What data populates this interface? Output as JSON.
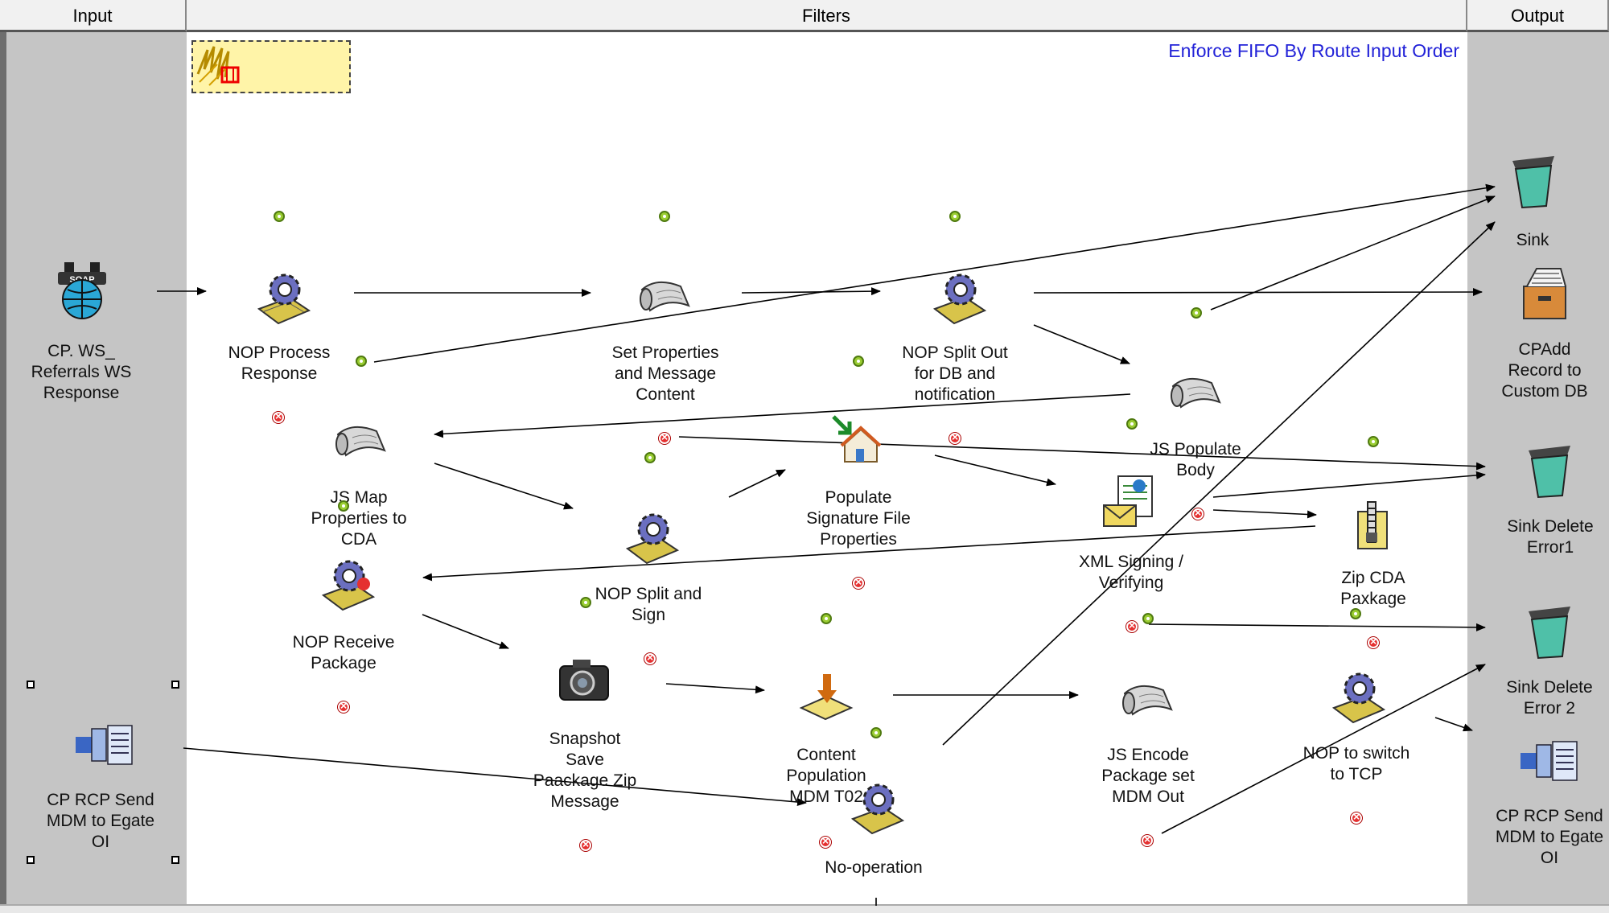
{
  "columns": {
    "input": "Input",
    "filters": "Filters",
    "output": "Output"
  },
  "banner": "Enforce FIFO By Route Input Order",
  "inputs": [
    {
      "label": "CP. WS_\nReferrals WS\nResponse",
      "icon": "soap-globe-icon"
    },
    {
      "label": "CP RCP Send\nMDM to Egate\nOI",
      "icon": "connector-icon"
    }
  ],
  "filters": [
    {
      "label": "NOP Process\nResponse",
      "icon": "gear-icon"
    },
    {
      "label": "Set Properties\nand Message\nContent",
      "icon": "scroll-icon"
    },
    {
      "label": "NOP Split Out\nfor DB and\nnotification",
      "icon": "gear-icon"
    },
    {
      "label": "JS Populate\nBody",
      "icon": "scroll-icon"
    },
    {
      "label": "JS Map\nProperties to\nCDA",
      "icon": "scroll-icon"
    },
    {
      "label": "Populate\nSignature File\nProperties",
      "icon": "house-icon"
    },
    {
      "label": "XML Signing /\nVerifying",
      "icon": "xml-mail-icon"
    },
    {
      "label": "NOP Split and\nSign",
      "icon": "gear-icon"
    },
    {
      "label": "Zip CDA\nPaxkage",
      "icon": "zip-icon"
    },
    {
      "label": "NOP Receive\nPackage",
      "icon": "gear-icon"
    },
    {
      "label": "Snapshot\nSave\nPaackage Zip\nMessage",
      "icon": "camera-icon"
    },
    {
      "label": "Content\nPopulation\nMDM T02",
      "icon": "content-icon"
    },
    {
      "label": "JS Encode\nPackage set\nMDM Out",
      "icon": "scroll-icon"
    },
    {
      "label": "NOP to switch\nto TCP",
      "icon": "gear-icon"
    },
    {
      "label": "No-operation",
      "icon": "gear-icon"
    }
  ],
  "outputs": [
    {
      "label": "Sink",
      "icon": "trash-icon"
    },
    {
      "label": "CPAdd\nRecord to\nCustom DB",
      "icon": "database-icon"
    },
    {
      "label": "Sink Delete\nError1",
      "icon": "trash-icon"
    },
    {
      "label": "Sink Delete\nError 2",
      "icon": "trash-icon"
    },
    {
      "label": "CP RCP Send\nMDM to Egate\nOI",
      "icon": "connector-icon"
    }
  ],
  "colors": {
    "ok": "#9acd32",
    "error": "#e53030",
    "banner": "#2222d8",
    "lane": "#c5c5c5"
  }
}
